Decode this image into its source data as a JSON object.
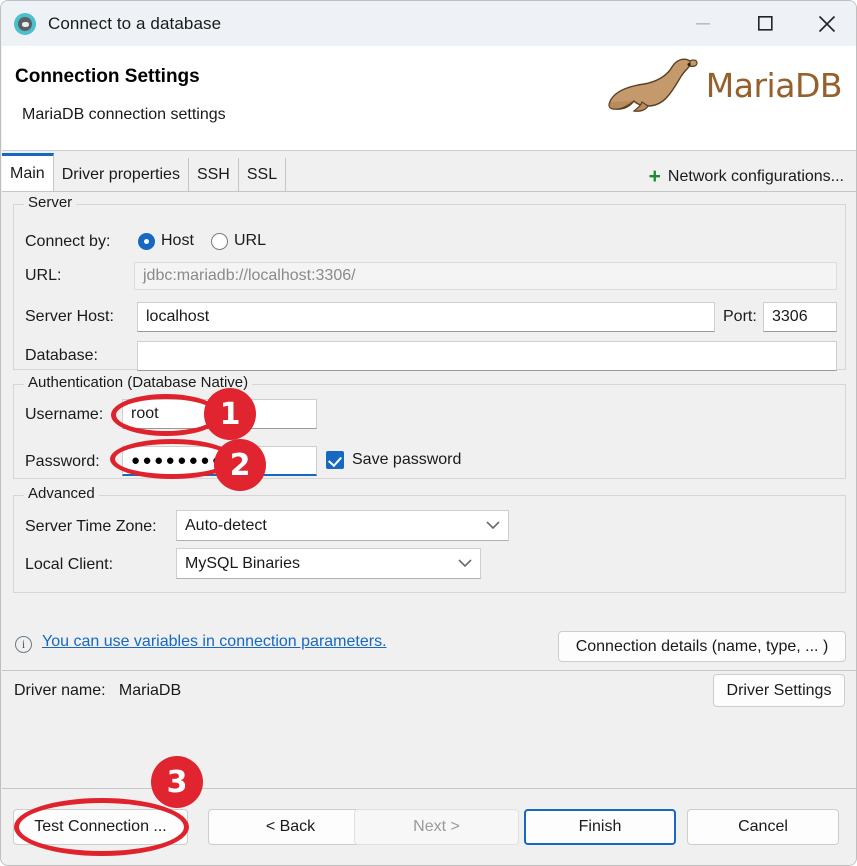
{
  "window": {
    "title": "Connect to a database",
    "app_icon": "dbeaver-beaver-icon",
    "controls": {
      "minimize": "minimize-icon",
      "maximize": "maximize-icon",
      "close": "close-icon"
    }
  },
  "header": {
    "title": "Connection Settings",
    "subtitle": "MariaDB connection settings",
    "logo_text": "MariaDB",
    "logo_color": "#96602c"
  },
  "tabs": {
    "items": [
      {
        "label": "Main",
        "active": true
      },
      {
        "label": "Driver properties",
        "active": false
      },
      {
        "label": "SSH",
        "active": false
      },
      {
        "label": "SSL",
        "active": false
      }
    ],
    "network_configurations": "Network configurations...",
    "plus_glyph": "+"
  },
  "server_group": {
    "legend": "Server",
    "connect_by_label": "Connect by:",
    "connect_by_options": [
      {
        "label": "Host",
        "selected": true
      },
      {
        "label": "URL",
        "selected": false
      }
    ],
    "url_label": "URL:",
    "url_value": "jdbc:mariadb://localhost:3306/",
    "server_host_label": "Server Host:",
    "server_host_value": "localhost",
    "port_label": "Port:",
    "port_value": "3306",
    "database_label": "Database:",
    "database_value": ""
  },
  "auth_group": {
    "legend": "Authentication (Database Native)",
    "username_label": "Username:",
    "username_value": "root",
    "password_label": "Password:",
    "password_value": "●●●●●●●●",
    "save_password_label": "Save password",
    "save_password_checked": true
  },
  "advanced_group": {
    "legend": "Advanced",
    "time_zone_label": "Server Time Zone:",
    "time_zone_value": "Auto-detect",
    "local_client_label": "Local Client:",
    "local_client_value": "MySQL Binaries",
    "caret_glyph": "⌄"
  },
  "link_row": {
    "info_icon": "info-icon",
    "info_glyph": "i",
    "variables_link": "You can use variables in connection parameters.",
    "connection_details_button": "Connection details (name, type, ... )"
  },
  "driver_row": {
    "driver_name_label": "Driver name:",
    "driver_name_value": "MariaDB",
    "driver_settings_button": "Driver Settings"
  },
  "footer": {
    "test_connection": "Test Connection ...",
    "back": "< Back",
    "next": "Next >",
    "finish": "Finish",
    "cancel": "Cancel",
    "next_disabled": true,
    "finish_is_default": true
  },
  "annotations": {
    "accent_color": "#e02430",
    "badges": [
      {
        "number": "1",
        "target": "username-field"
      },
      {
        "number": "2",
        "target": "password-field"
      },
      {
        "number": "3",
        "target": "test-connection-button"
      }
    ]
  }
}
